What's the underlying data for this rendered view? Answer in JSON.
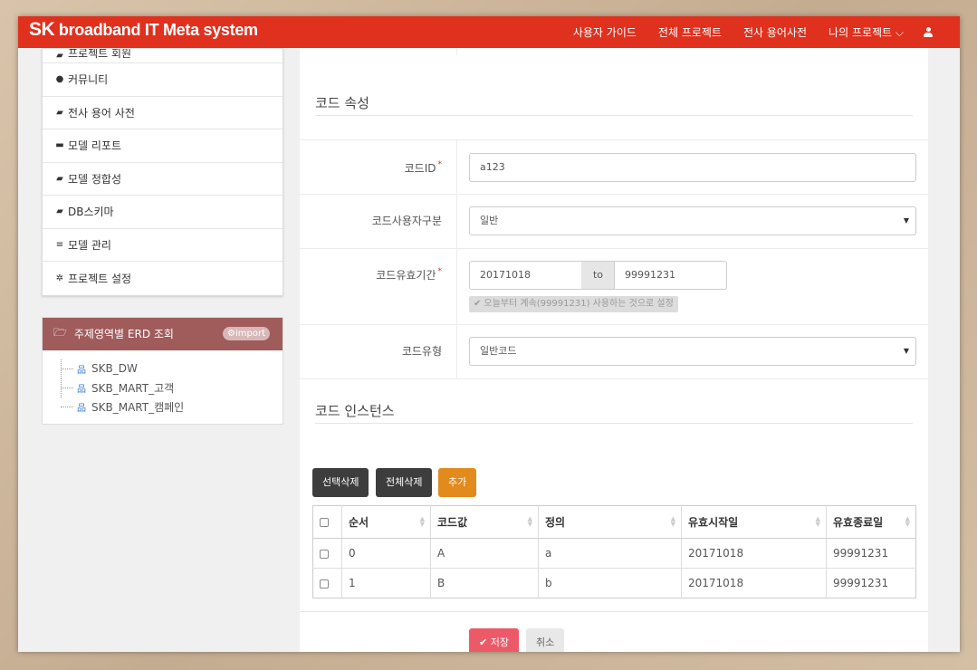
{
  "header": {
    "brand_sk": "SK",
    "brand_rest": " broadband IT Meta system",
    "nav": [
      "사용자 가이드",
      "전체 프로젝트",
      "전사 용어사전",
      "나의 프로젝트 ⌵"
    ]
  },
  "sidebar": {
    "menu": [
      {
        "icon": "book-icon",
        "label": "프로젝트 회원"
      },
      {
        "icon": "comments-icon",
        "label": "커뮤니티"
      },
      {
        "icon": "book-icon",
        "label": "전사 용어 사전"
      },
      {
        "icon": "archive-icon",
        "label": "모델 리포트"
      },
      {
        "icon": "book-icon",
        "label": "모델 정합성"
      },
      {
        "icon": "book-icon",
        "label": "DB스키마"
      },
      {
        "icon": "database-icon",
        "label": "모델 관리"
      },
      {
        "icon": "gear-icon",
        "label": "프로젝트 설정"
      }
    ],
    "erd": {
      "title": "주제영역별 ERD 조회",
      "import_label": "import",
      "tree": [
        "SKB_DW",
        "SKB_MART_고객",
        "SKB_MART_캠페인"
      ]
    }
  },
  "code_attr": {
    "title": "코드 속성",
    "code_id_label": "코드ID",
    "code_id_value": "a123",
    "user_type_label": "코드사용자구분",
    "user_type_value": "일반",
    "validity_label": "코드유효기간",
    "start_date": "20171018",
    "to_label": "to",
    "end_date": "99991231",
    "validity_hint": "오늘부터 계속(99991231) 사용하는 것으로 설정",
    "code_type_label": "코드유형",
    "code_type_value": "일반코드",
    "required_mark": "*"
  },
  "instance": {
    "title": "코드 인스턴스",
    "buttons": {
      "delete_selected": "선택삭제",
      "delete_all": "전체삭제",
      "add": "추가"
    },
    "columns": [
      "순서",
      "코드값",
      "정의",
      "유효시작일",
      "유효종료일"
    ],
    "rows": [
      [
        "0",
        "A",
        "a",
        "20171018",
        "99991231"
      ],
      [
        "1",
        "B",
        "b",
        "20171018",
        "99991231"
      ]
    ]
  },
  "footer": {
    "save": "저장",
    "cancel": "취소"
  }
}
